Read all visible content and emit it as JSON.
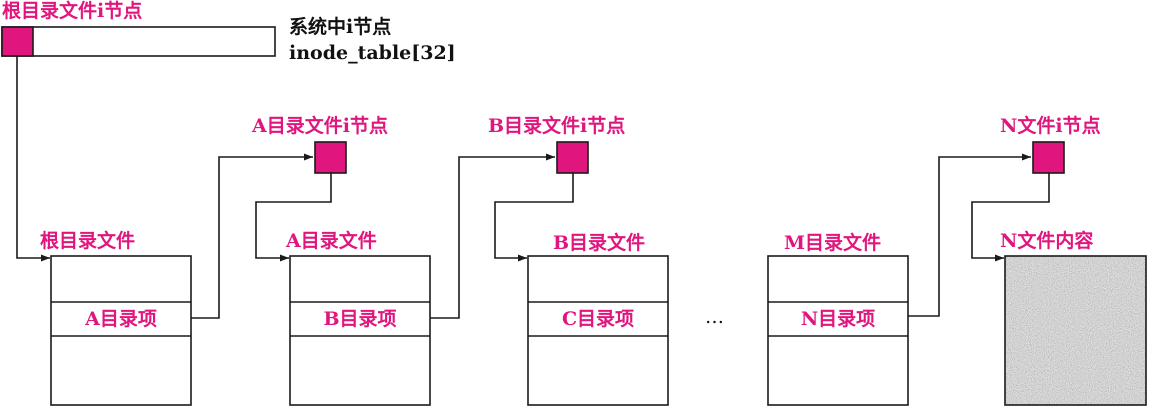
{
  "colors": {
    "accent": "#e0157e",
    "line": "#1a1a1a",
    "content_fill": "#b0b0b0"
  },
  "inode_table": {
    "title": "根目录文件i节点",
    "system_label": "系统中i节点",
    "array_label": "inode_table[32]"
  },
  "inodes": {
    "a_dir": "A目录文件i节点",
    "b_dir": "B目录文件i节点",
    "n_file": "N文件i节点"
  },
  "dir_files": [
    {
      "title": "根目录文件",
      "entry": "A目录项"
    },
    {
      "title": "A目录文件",
      "entry": "B目录项"
    },
    {
      "title": "B目录文件",
      "entry": "C目录项"
    },
    {
      "title": "M目录文件",
      "entry": "N目录项"
    }
  ],
  "ellipsis": "…",
  "file_content": {
    "title": "N文件内容"
  }
}
